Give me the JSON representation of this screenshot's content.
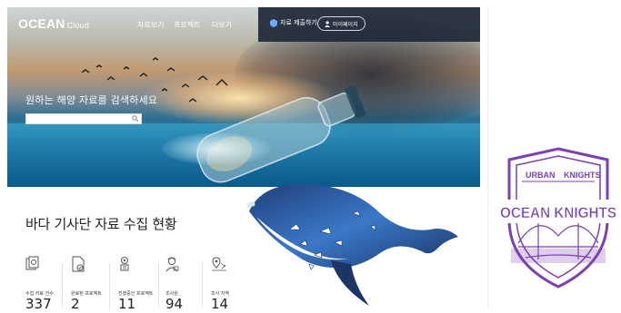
{
  "site": {
    "logo_main": "OCEAN",
    "logo_sub": "Cloud",
    "nav": [
      "자료보기",
      "프로젝트",
      "더보기"
    ],
    "request_label": "자료 제출하기",
    "mypage_label": "마이페이지",
    "hero_title": "원하는 해양 자료를 검색하세요",
    "search_placeholder": "",
    "stats_title": "바다 기사단 자료 수집 현황",
    "stats": [
      {
        "label": "수집 자료 건수",
        "value": "337",
        "icon": "document-stack-icon"
      },
      {
        "label": "완료된 프로젝트",
        "value": "2",
        "icon": "document-check-icon"
      },
      {
        "label": "진행중인 프로젝트",
        "value": "11",
        "icon": "gear-progress-icon"
      },
      {
        "label": "조사원",
        "value": "94",
        "icon": "surveyor-icon"
      },
      {
        "label": "조사 지역",
        "value": "14",
        "icon": "map-pin-icon"
      }
    ]
  },
  "crest": {
    "top_left": "URBAN",
    "top_right": "KNIGHTS",
    "main": "OCEAN KNIGHTS",
    "color": "#7c3fb4"
  },
  "colors": {
    "nav_dark": "#202838",
    "whale": "#2f63b0",
    "crest_purple": "#7c3fb4"
  }
}
